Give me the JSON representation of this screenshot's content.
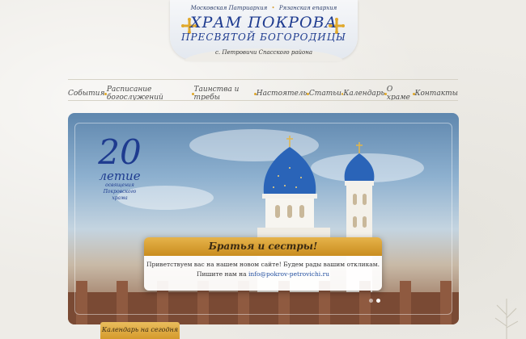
{
  "header": {
    "top_left": "Московская Патриархия",
    "top_right": "Рязанская епархия",
    "title_line1": "ХРАМ ПОКРОВА",
    "title_line2": "ПРЕСВЯТОЙ БОГОРОДИЦЫ",
    "subtitle": "с. Петровичи Спасского района"
  },
  "nav": {
    "items": [
      {
        "label": "События"
      },
      {
        "label": "Расписание богослужений"
      },
      {
        "label": "Таинства и требы"
      },
      {
        "label": "Настоятель"
      },
      {
        "label": "Статьи"
      },
      {
        "label": "Календарь"
      },
      {
        "label": "О храме"
      },
      {
        "label": "Контакты"
      }
    ]
  },
  "slider": {
    "jubilee": {
      "number": "20",
      "word": "летие",
      "caption_line1": "освящения",
      "caption_line2": "Покровского храма"
    },
    "notice": {
      "heading": "Братья и сестры!",
      "line1": "Приветствуем вас на нашем новом сайте! Будем рады вашим откликам.",
      "line2_prefix": "Пишите нам на ",
      "email": "info@pokrov-petrovichi.ru"
    },
    "active_slide": 2,
    "slide_count": 2
  },
  "calendar_tab": {
    "label": "Календарь на сегодня"
  },
  "colors": {
    "accent_gold": "#d8a23a",
    "brand_blue": "#1e3b8f",
    "link_blue": "#2450a0"
  }
}
